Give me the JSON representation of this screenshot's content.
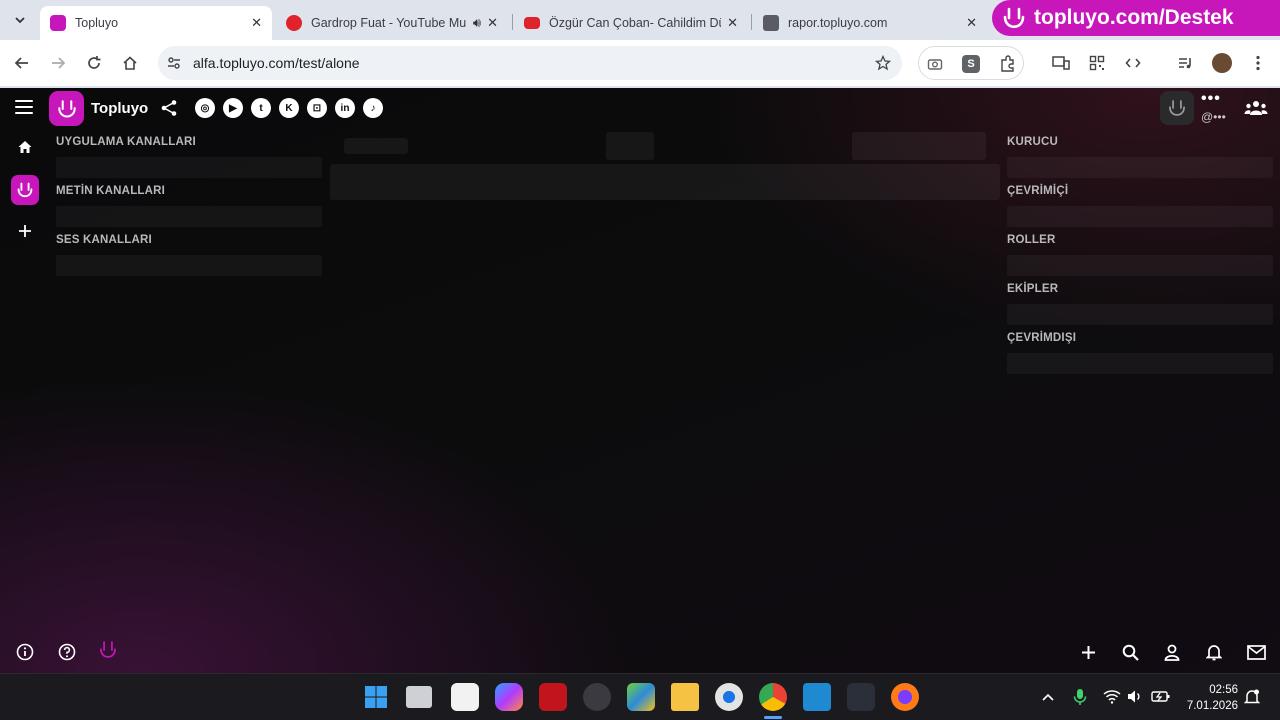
{
  "browser": {
    "tabs": [
      {
        "title": "Topluyo",
        "active": true
      },
      {
        "title": "Gardrop Fuat - YouTube Mu",
        "active": false
      },
      {
        "title": "Özgür Can Çoban- Cahildim Dü",
        "active": false
      },
      {
        "title": "rapor.topluyo.com",
        "active": false
      }
    ],
    "promo_text": "topluyo.com/Destek",
    "url": "alfa.topluyo.com/test/alone",
    "ext_letter": "S"
  },
  "app": {
    "brand_name": "Topluyo",
    "social_icons": [
      "instagram-icon",
      "youtube-icon",
      "twitter-icon",
      "kick-icon",
      "twitch-icon",
      "linkedin-icon",
      "tiktok-icon"
    ],
    "social_glyphs": [
      "◎",
      "▶",
      "t",
      "K",
      "⊡",
      "in",
      "♪"
    ],
    "left_sections": [
      "UYGULAMA KANALLARI",
      "METİN KANALLARI",
      "SES KANALLARI"
    ],
    "right_sections": [
      "KURUCU",
      "ÇEVRİMİÇİ",
      "ROLLER",
      "EKİPLER",
      "ÇEVRİMDIŞI"
    ],
    "user_dots": "•••",
    "user_handle": "@•••",
    "accent": "#c716b9"
  },
  "taskbar": {
    "time": "02:56",
    "date": "7.01.2026"
  }
}
